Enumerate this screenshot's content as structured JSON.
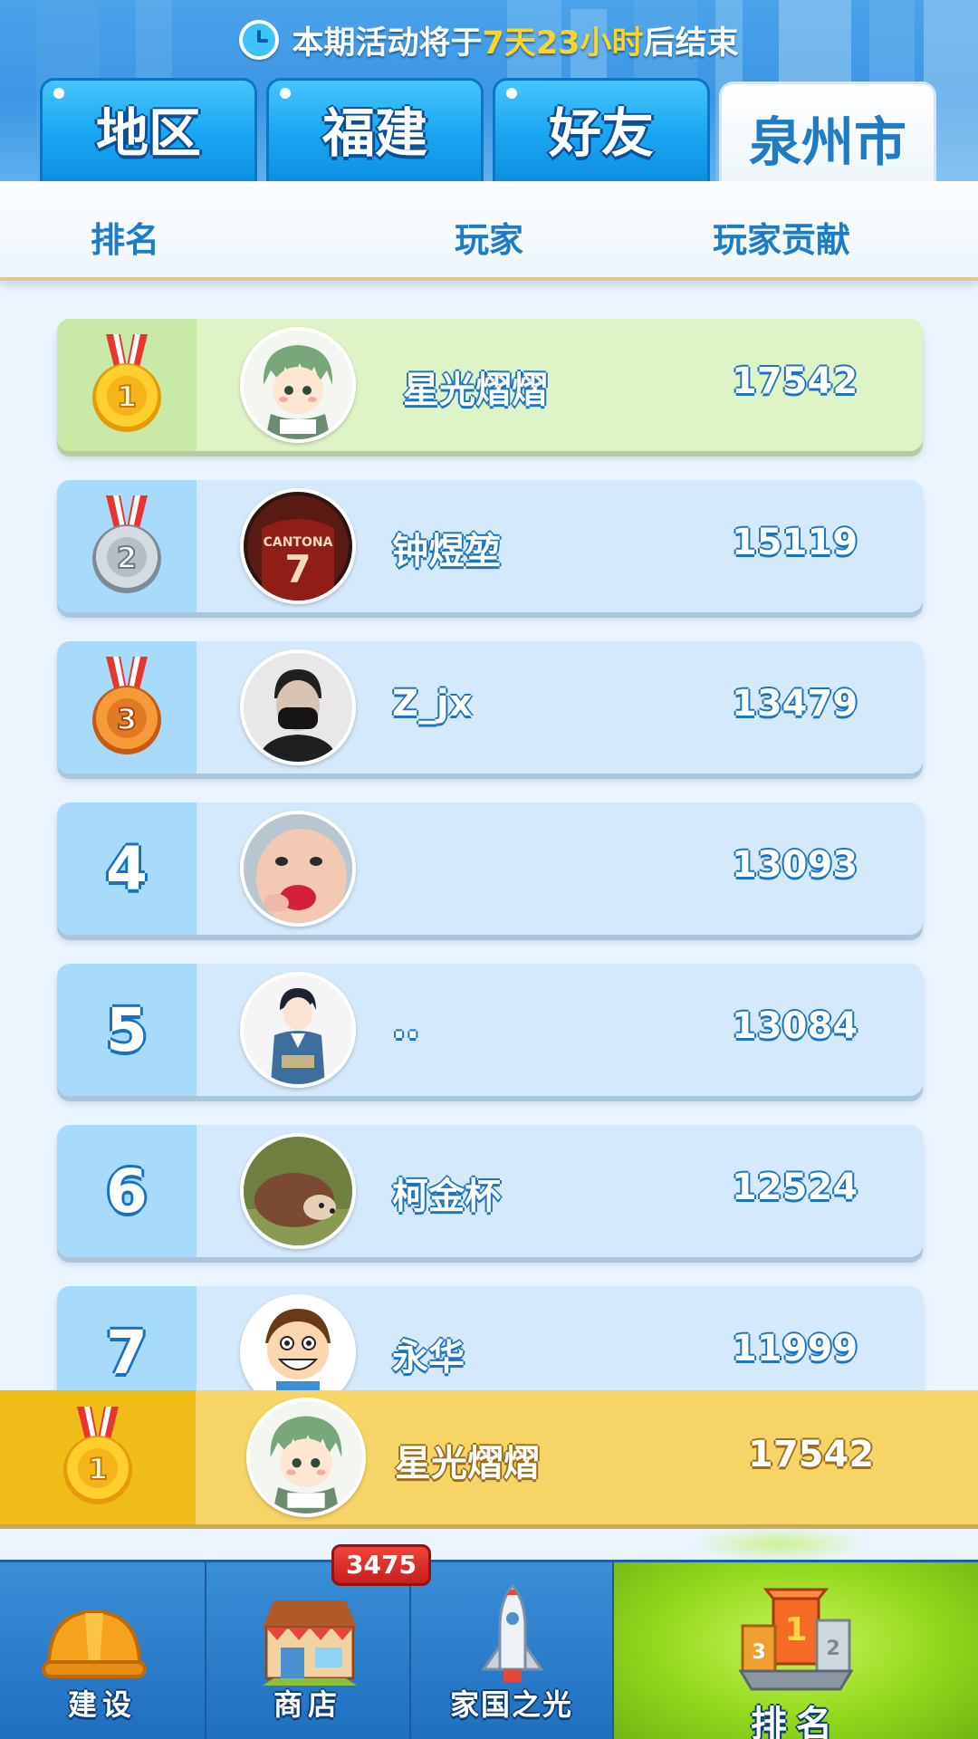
{
  "header": {
    "timer_prefix": "本期活动将于",
    "timer_highlight": "7天23小时",
    "timer_suffix": "后结束",
    "tabs": [
      {
        "label": "地区",
        "active": false
      },
      {
        "label": "福建",
        "active": false
      },
      {
        "label": "好友",
        "active": false
      },
      {
        "label": "泉州市",
        "active": true
      }
    ]
  },
  "columns": {
    "rank": "排名",
    "player": "玩家",
    "contribution": "玩家贡献"
  },
  "rows": [
    {
      "rank": "1",
      "medal": "gold-medal-icon",
      "name": "星光熠熠",
      "score": "17542",
      "avatar": "anime-boy-avatar"
    },
    {
      "rank": "2",
      "medal": "silver-medal-icon",
      "name": "钟煜堃",
      "score": "15119",
      "avatar": "jersey-avatar"
    },
    {
      "rank": "3",
      "medal": "bronze-medal-icon",
      "name": "Z_jx",
      "score": "13479",
      "avatar": "masked-man-avatar"
    },
    {
      "rank": "4",
      "medal": null,
      "name": "",
      "score": "13093",
      "avatar": "child-avatar"
    },
    {
      "rank": "5",
      "medal": null,
      "name": "..",
      "score": "13084",
      "avatar": "reading-boy-avatar"
    },
    {
      "rank": "6",
      "medal": null,
      "name": "柯金杯",
      "score": "12524",
      "avatar": "hedgehog-avatar"
    },
    {
      "rank": "7",
      "medal": null,
      "name": "永华",
      "score": "11999",
      "avatar": "cartoon-boy-avatar"
    }
  ],
  "my_row": {
    "rank": "1",
    "medal": "gold-medal-icon",
    "name": "星光熠熠",
    "score": "17542"
  },
  "nav": {
    "items": [
      {
        "label": "建设",
        "icon": "hardhat-icon"
      },
      {
        "label": "商店",
        "icon": "shop-icon",
        "badge": "3475"
      },
      {
        "label": "家国之光",
        "icon": "rocket-icon"
      },
      {
        "label": "排名",
        "icon": "podium-icon",
        "active": true
      }
    ]
  },
  "colors": {
    "tab_blue": "#19a5f1",
    "row_blue": "#d4e9fb",
    "row_first": "#dff4c6",
    "my_row": "#f6d566",
    "nav_active": "#93d81c",
    "highlight_text": "#ffd42a"
  }
}
